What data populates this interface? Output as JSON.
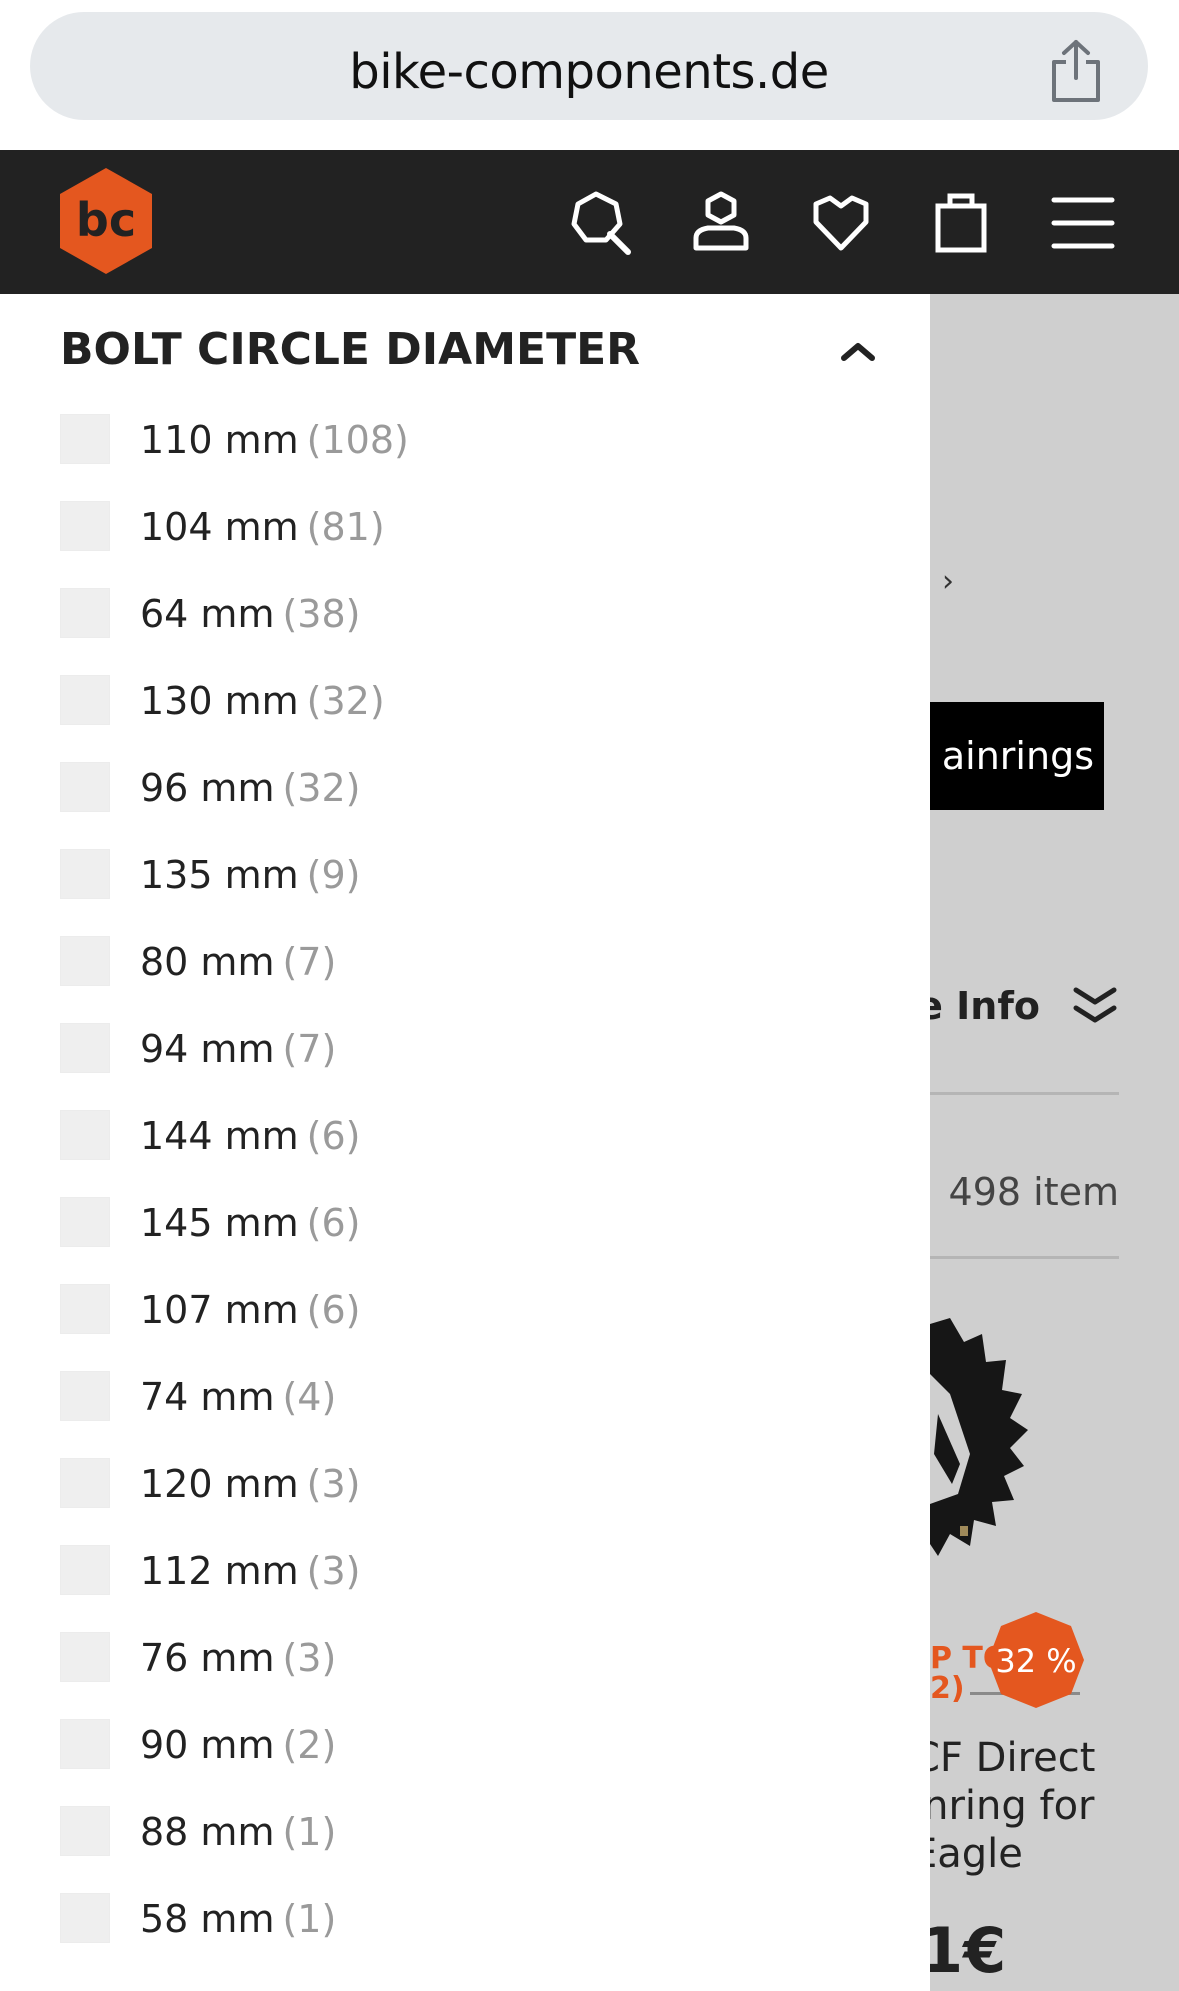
{
  "browser": {
    "url": "bike-components.de"
  },
  "header": {
    "logo_label": "bc",
    "icons": [
      "search-icon",
      "account-icon",
      "wishlist-icon",
      "cart-icon",
      "menu-icon"
    ]
  },
  "colors": {
    "brand": "#e4571f",
    "header_bg": "#222222",
    "checkbox": "#efefef",
    "count_text": "#9a9a9a"
  },
  "filter": {
    "title": "BOLT CIRCLE DIAMETER",
    "options": [
      {
        "label": "110 mm",
        "count": "(108)"
      },
      {
        "label": "104 mm",
        "count": "(81)"
      },
      {
        "label": "64 mm",
        "count": "(38)"
      },
      {
        "label": "130 mm",
        "count": "(32)"
      },
      {
        "label": "96 mm",
        "count": "(32)"
      },
      {
        "label": "135 mm",
        "count": "(9)"
      },
      {
        "label": "80 mm",
        "count": "(7)"
      },
      {
        "label": "94 mm",
        "count": "(7)"
      },
      {
        "label": "144 mm",
        "count": "(6)"
      },
      {
        "label": "145 mm",
        "count": "(6)"
      },
      {
        "label": "107 mm",
        "count": "(6)"
      },
      {
        "label": "74 mm",
        "count": "(4)"
      },
      {
        "label": "120 mm",
        "count": "(3)"
      },
      {
        "label": "112 mm",
        "count": "(3)"
      },
      {
        "label": "76 mm",
        "count": "(3)"
      },
      {
        "label": "90 mm",
        "count": "(2)"
      },
      {
        "label": "88 mm",
        "count": "(1)"
      },
      {
        "label": "58 mm",
        "count": "(1)"
      }
    ]
  },
  "background_page": {
    "breadcrumb_chevron": "›",
    "category_button": "ainrings",
    "info_label": "e Info",
    "item_count": "498 item",
    "upto_line1": "P TO",
    "upto_line2": "2)",
    "discount_badge": "32 %",
    "product_title_lines": [
      "CF Direct",
      "inring for",
      "Eagle"
    ],
    "price": "1€"
  }
}
